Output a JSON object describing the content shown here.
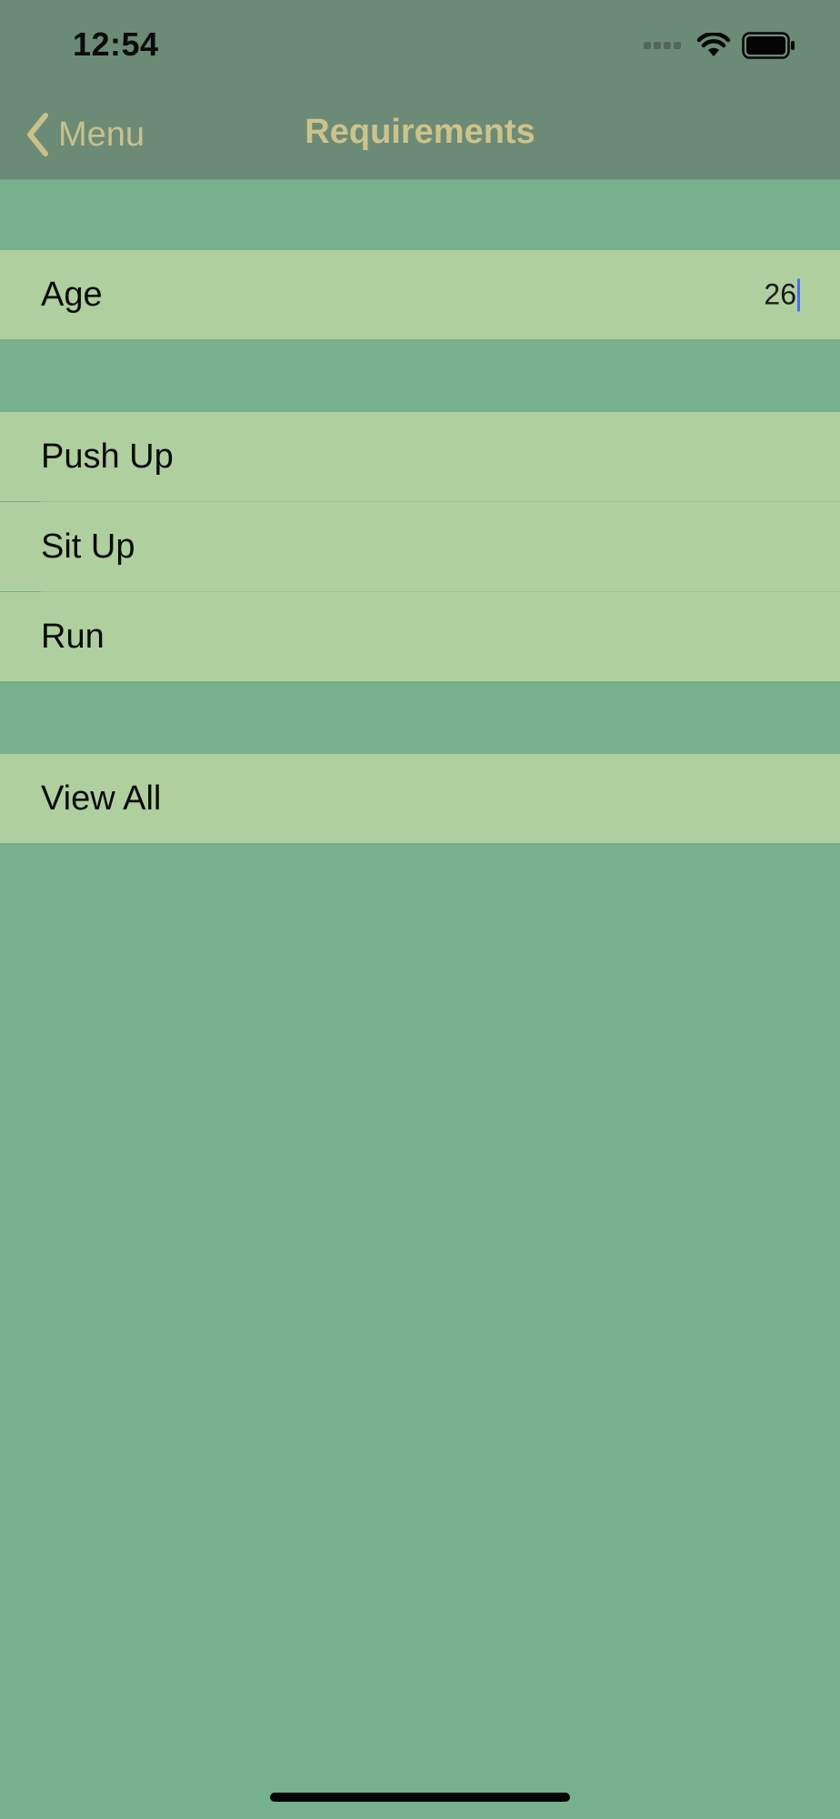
{
  "status_bar": {
    "time": "12:54"
  },
  "nav": {
    "back_label": "Menu",
    "title": "Requirements"
  },
  "age_section": {
    "label": "Age",
    "value": "26"
  },
  "requirements": [
    {
      "label": "Push Up"
    },
    {
      "label": "Sit Up"
    },
    {
      "label": "Run"
    }
  ],
  "view_all": {
    "label": "View All"
  },
  "colors": {
    "background": "#76b08c",
    "nav_bar": "#6b8b77",
    "cell": "#b0cf9f",
    "nav_text": "#cdc38a",
    "caret": "#4a6ef0"
  }
}
